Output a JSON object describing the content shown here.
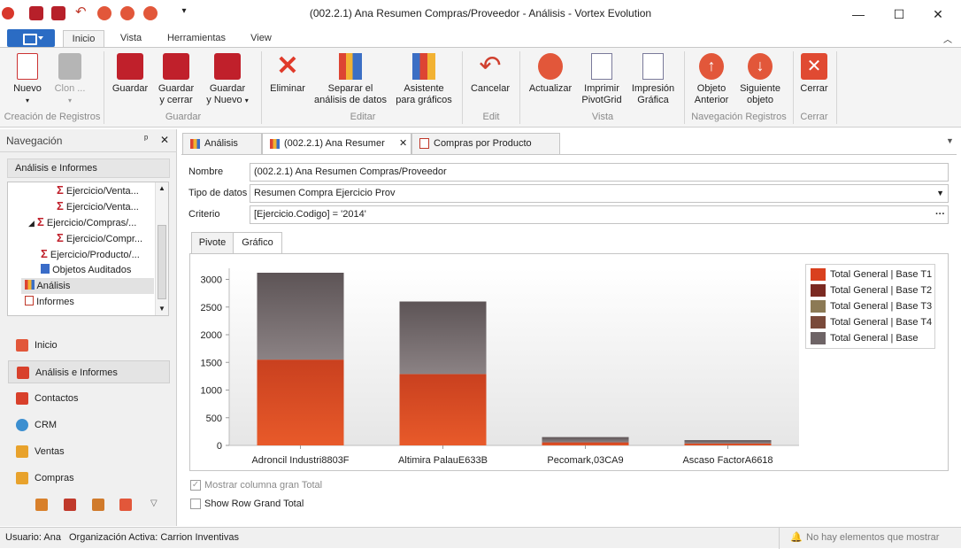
{
  "window": {
    "title": "(002.2.1) Ana Resumen Compras/Proveedor - Análisis - Vortex Evolution",
    "minimize": "—",
    "maximize": "☐",
    "close": "✕"
  },
  "ribbon_tabs": [
    "Inicio",
    "Vista",
    "Herramientas",
    "View"
  ],
  "ribbon": {
    "buttons": {
      "nuevo": "Nuevo",
      "clon": "Clon ...",
      "guardar": "Guardar",
      "guardar_cerrar_1": "Guardar",
      "guardar_cerrar_2": "y cerrar",
      "guardar_nuevo_1": "Guardar",
      "guardar_nuevo_2": "y Nuevo",
      "eliminar": "Eliminar",
      "separar_1": "Separar el",
      "separar_2": "análisis de datos",
      "asistente_1": "Asistente",
      "asistente_2": "para gráficos",
      "cancelar": "Cancelar",
      "actualizar": "Actualizar",
      "imprimir_1": "Imprimir",
      "imprimir_2": "PivotGrid",
      "impresion_1": "Impresión",
      "impresion_2": "Gráfica",
      "objeto_ant_1": "Objeto",
      "objeto_ant_2": "Anterior",
      "siguiente_1": "Siguiente",
      "siguiente_2": "objeto",
      "cerrar": "Cerrar"
    },
    "groups": {
      "creacion": "Creación de Registros",
      "guardar": "Guardar",
      "editar": "Editar",
      "edit": "Edit",
      "vista": "Vista",
      "navegacion": "Navegación Registros",
      "cerrar": "Cerrar"
    }
  },
  "nav": {
    "title": "Navegación",
    "pin": "ᵖ",
    "close": "✕",
    "section": "Análisis e Informes",
    "tree": [
      "Ejercicio/Venta...",
      "Ejercicio/Venta...",
      "Ejercicio/Compras/...",
      "Ejercicio/Compr...",
      "Ejercicio/Producto/...",
      "Objetos Auditados",
      "Análisis",
      "Informes"
    ],
    "buttons": [
      "Inicio",
      "Análisis e Informes",
      "Contactos",
      "CRM",
      "Ventas",
      "Compras"
    ]
  },
  "doc_tabs": [
    "Análisis",
    "(002.2.1) Ana Resumer",
    "Compras por Producto"
  ],
  "form": {
    "nombre_label": "Nombre",
    "nombre_value": "(002.2.1) Ana Resumen Compras/Proveedor",
    "tipo_label": "Tipo de datos",
    "tipo_value": "Resumen Compra Ejercicio Prov",
    "criterio_label": "Criterio",
    "criterio_value": "[Ejercicio.Codigo]  = '2014'",
    "criterio_btn": "···"
  },
  "inner_tabs": [
    "Pivote",
    "Gráfico"
  ],
  "chart_data": {
    "type": "bar",
    "stacked": true,
    "categories": [
      "Adroncil Industri8803F",
      "Altimira PalauE633B",
      "Pecomark,03CA9",
      "Ascaso FactorA6618"
    ],
    "series": [
      {
        "name": "Total General | Base T1",
        "values": [
          1550,
          1290,
          55,
          35
        ],
        "color": "#d9401e"
      },
      {
        "name": "Total General | Base T2",
        "values": [
          0,
          0,
          0,
          0
        ],
        "color": "#7b2a22"
      },
      {
        "name": "Total General | Base T3",
        "values": [
          0,
          0,
          0,
          0
        ],
        "color": "#8c7a55"
      },
      {
        "name": "Total General | Base T4",
        "values": [
          0,
          0,
          0,
          0
        ],
        "color": "#7a4a3a"
      },
      {
        "name": "Total General | Base",
        "values": [
          1570,
          1310,
          95,
          60
        ],
        "color": "#6e6466"
      }
    ],
    "yticks": [
      "3000",
      "2500",
      "2000",
      "1500",
      "1000",
      "500",
      "0"
    ],
    "ylim": [
      0,
      3200
    ],
    "legend_position": "top-right",
    "grid": false
  },
  "options": {
    "mostrar_total": "Mostrar columna gran Total",
    "show_row_total": "Show Row Grand Total",
    "check_mark": "✓"
  },
  "status": {
    "usuario": "Usuario: Ana",
    "organizacion": "Organización Activa: Carrion Inventivas",
    "right": "No hay elementos que mostrar"
  }
}
